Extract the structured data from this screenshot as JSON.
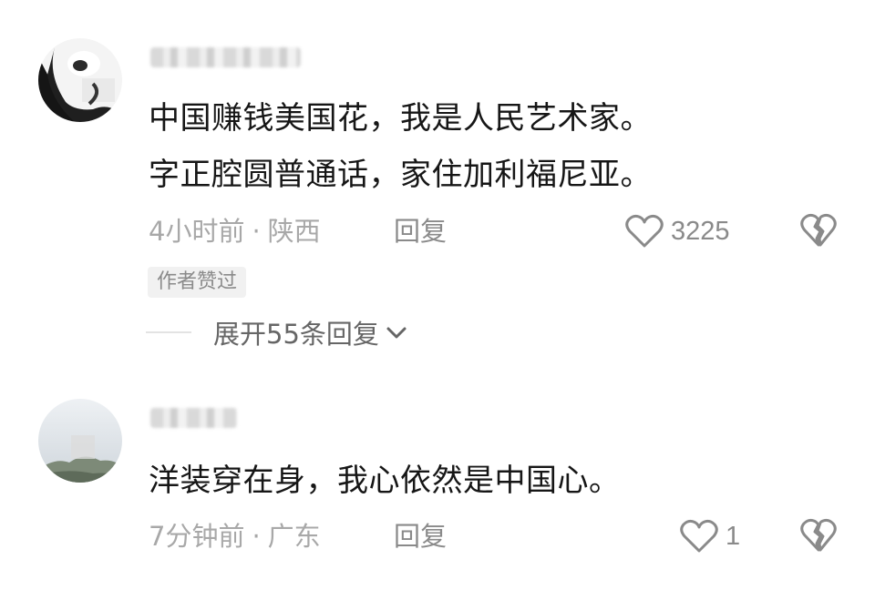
{
  "comments": [
    {
      "lines": [
        "中国赚钱美国花，我是人民艺术家。",
        "字正腔圆普通话，家住加利福尼亚。"
      ],
      "time": "4小时前",
      "location": "陕西",
      "reply_label": "回复",
      "like_count": "3225",
      "badge": "作者赞过",
      "expand_label": "展开55条回复"
    },
    {
      "lines": [
        "洋装穿在身，我心依然是中国心。"
      ],
      "time": "7分钟前",
      "location": "广东",
      "reply_label": "回复",
      "like_count": "1"
    }
  ],
  "meta_separator": "·",
  "icons": {
    "like": "heart-outline-icon",
    "dislike": "broken-heart-icon",
    "expand": "chevron-down-icon"
  },
  "colors": {
    "text": "#161616",
    "meta": "#a8a8a8",
    "action": "#8a8a8a",
    "badge_bg": "#f1f1f1"
  }
}
